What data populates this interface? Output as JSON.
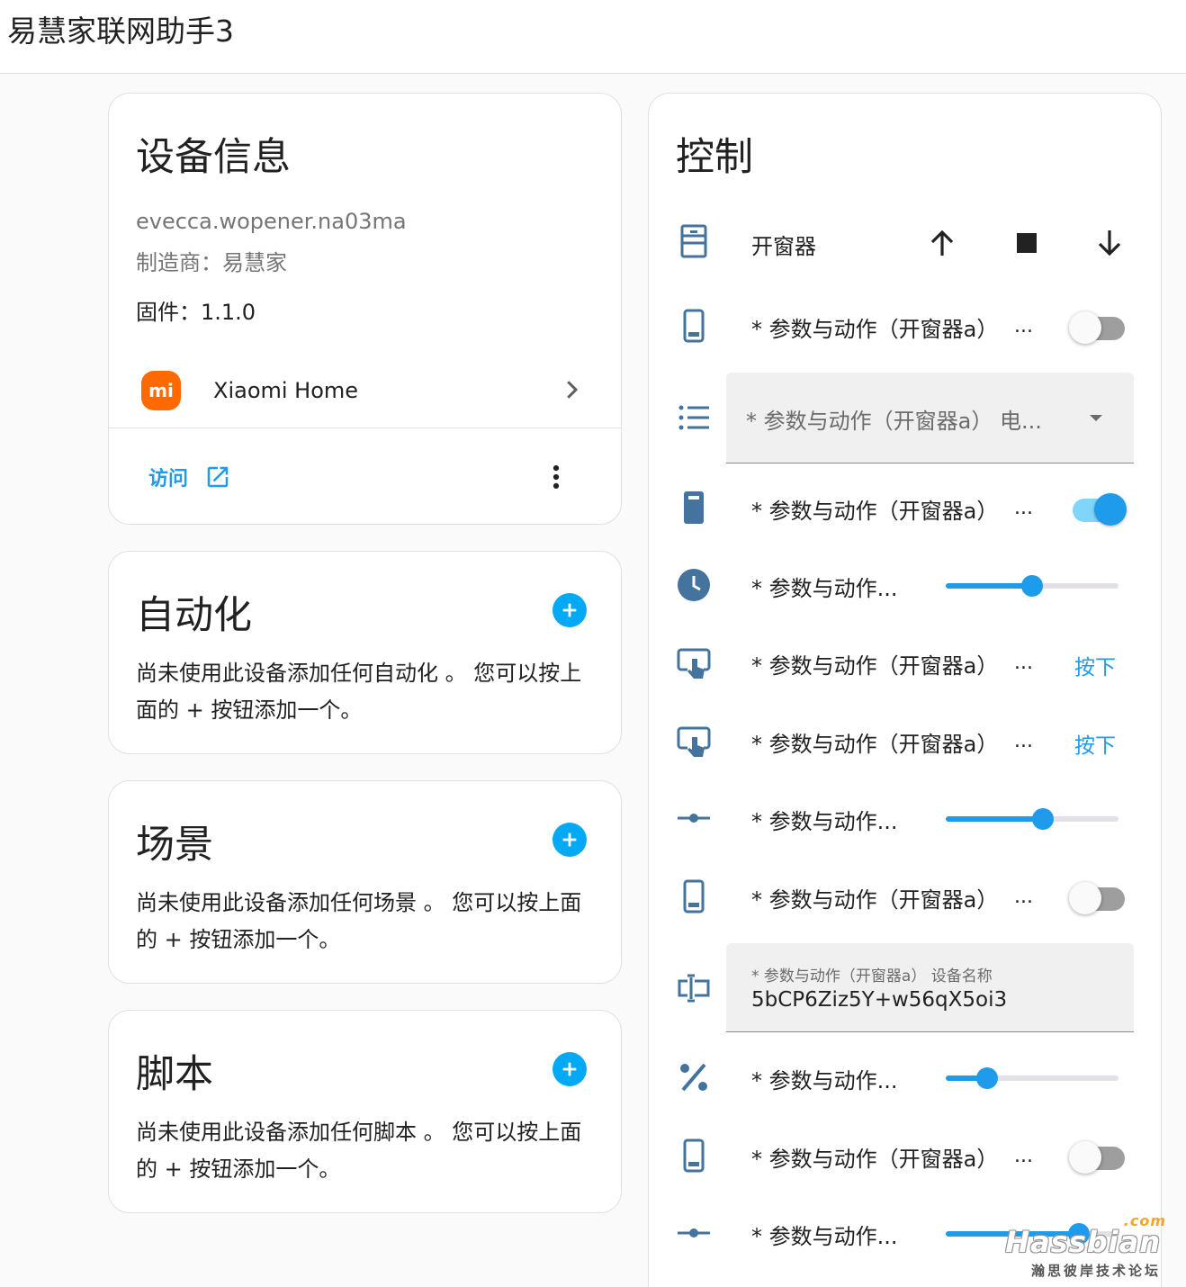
{
  "app": {
    "title": "易慧家联网助手3"
  },
  "device_info": {
    "title": "设备信息",
    "model": "evecca.wopener.na03ma",
    "manufacturer": "制造商：易慧家",
    "firmware": "固件：1.1.0",
    "integration_name": "Xiaomi Home",
    "integration_logo_text": "mi",
    "visit_label": "访问",
    "colors": {
      "accent": "#03a9f4",
      "mi_orange": "#ff6900"
    }
  },
  "automation": {
    "title": "自动化",
    "empty_text": "尚未使用此设备添加任何自动化 。 您可以按上面的 + 按钮添加一个。"
  },
  "scene": {
    "title": "场景",
    "empty_text": "尚未使用此设备添加任何场景 。 您可以按上面的 + 按钮添加一个。"
  },
  "script": {
    "title": "脚本",
    "empty_text": "尚未使用此设备添加任何脚本 。 您可以按上面的 + 按钮添加一个。"
  },
  "controls": {
    "title": "控制",
    "cover": {
      "label": "开窗器",
      "icon": "window-shutter-icon"
    },
    "row_switch_1": {
      "label": "* 参数与动作（开窗器a）",
      "ellipsis": "...",
      "state": "off"
    },
    "select_1": {
      "value": "* 参数与动作（开窗器a） 电...",
      "icon": "list-icon"
    },
    "row_switch_2": {
      "label": "* 参数与动作（开窗器a）",
      "ellipsis": "...",
      "state": "on"
    },
    "slider_1": {
      "label": "* 参数与动作...",
      "value": 0.5,
      "icon": "clock-icon"
    },
    "button_1": {
      "label": "* 参数与动作（开窗器a）",
      "ellipsis": "...",
      "action": "按下"
    },
    "button_2": {
      "label": "* 参数与动作（开窗器a）",
      "ellipsis": "...",
      "action": "按下"
    },
    "slider_2": {
      "label": "* 参数与动作...",
      "value": 0.56,
      "icon": "ray-vertex-icon"
    },
    "row_switch_3": {
      "label": "* 参数与动作（开窗器a）",
      "ellipsis": "...",
      "state": "off"
    },
    "text_1": {
      "label": "* 参数与动作（开窗器a） 设备名称",
      "value": "5bCP6Ziz5Y+w56qX5oi3",
      "icon": "form-textbox-icon"
    },
    "slider_3": {
      "label": "* 参数与动作...",
      "value": 0.24,
      "icon": "percent-icon"
    },
    "row_switch_4": {
      "label": "* 参数与动作（开窗器a）",
      "ellipsis": "...",
      "state": "off"
    },
    "slider_4": {
      "label": "* 参数与动作...",
      "value": 0.77,
      "icon": "ray-vertex-icon"
    }
  },
  "watermark": {
    "logo": "Hassbian",
    "com": ".com",
    "subtitle": "瀚思彼岸技术论坛"
  }
}
